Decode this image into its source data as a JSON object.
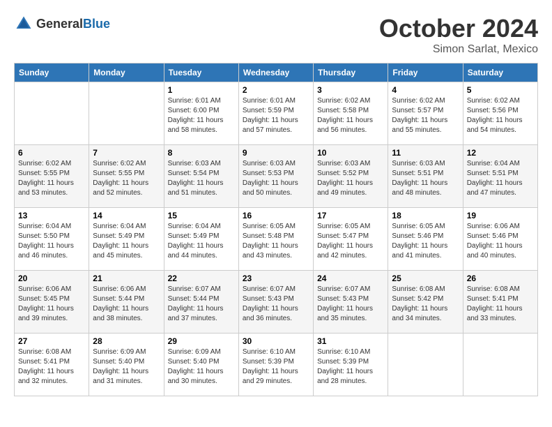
{
  "header": {
    "logo_general": "General",
    "logo_blue": "Blue",
    "month": "October 2024",
    "location": "Simon Sarlat, Mexico"
  },
  "weekdays": [
    "Sunday",
    "Monday",
    "Tuesday",
    "Wednesday",
    "Thursday",
    "Friday",
    "Saturday"
  ],
  "weeks": [
    [
      {
        "day": "",
        "info": ""
      },
      {
        "day": "",
        "info": ""
      },
      {
        "day": "1",
        "info": "Sunrise: 6:01 AM\nSunset: 6:00 PM\nDaylight: 11 hours and 58 minutes."
      },
      {
        "day": "2",
        "info": "Sunrise: 6:01 AM\nSunset: 5:59 PM\nDaylight: 11 hours and 57 minutes."
      },
      {
        "day": "3",
        "info": "Sunrise: 6:02 AM\nSunset: 5:58 PM\nDaylight: 11 hours and 56 minutes."
      },
      {
        "day": "4",
        "info": "Sunrise: 6:02 AM\nSunset: 5:57 PM\nDaylight: 11 hours and 55 minutes."
      },
      {
        "day": "5",
        "info": "Sunrise: 6:02 AM\nSunset: 5:56 PM\nDaylight: 11 hours and 54 minutes."
      }
    ],
    [
      {
        "day": "6",
        "info": "Sunrise: 6:02 AM\nSunset: 5:55 PM\nDaylight: 11 hours and 53 minutes."
      },
      {
        "day": "7",
        "info": "Sunrise: 6:02 AM\nSunset: 5:55 PM\nDaylight: 11 hours and 52 minutes."
      },
      {
        "day": "8",
        "info": "Sunrise: 6:03 AM\nSunset: 5:54 PM\nDaylight: 11 hours and 51 minutes."
      },
      {
        "day": "9",
        "info": "Sunrise: 6:03 AM\nSunset: 5:53 PM\nDaylight: 11 hours and 50 minutes."
      },
      {
        "day": "10",
        "info": "Sunrise: 6:03 AM\nSunset: 5:52 PM\nDaylight: 11 hours and 49 minutes."
      },
      {
        "day": "11",
        "info": "Sunrise: 6:03 AM\nSunset: 5:51 PM\nDaylight: 11 hours and 48 minutes."
      },
      {
        "day": "12",
        "info": "Sunrise: 6:04 AM\nSunset: 5:51 PM\nDaylight: 11 hours and 47 minutes."
      }
    ],
    [
      {
        "day": "13",
        "info": "Sunrise: 6:04 AM\nSunset: 5:50 PM\nDaylight: 11 hours and 46 minutes."
      },
      {
        "day": "14",
        "info": "Sunrise: 6:04 AM\nSunset: 5:49 PM\nDaylight: 11 hours and 45 minutes."
      },
      {
        "day": "15",
        "info": "Sunrise: 6:04 AM\nSunset: 5:49 PM\nDaylight: 11 hours and 44 minutes."
      },
      {
        "day": "16",
        "info": "Sunrise: 6:05 AM\nSunset: 5:48 PM\nDaylight: 11 hours and 43 minutes."
      },
      {
        "day": "17",
        "info": "Sunrise: 6:05 AM\nSunset: 5:47 PM\nDaylight: 11 hours and 42 minutes."
      },
      {
        "day": "18",
        "info": "Sunrise: 6:05 AM\nSunset: 5:46 PM\nDaylight: 11 hours and 41 minutes."
      },
      {
        "day": "19",
        "info": "Sunrise: 6:06 AM\nSunset: 5:46 PM\nDaylight: 11 hours and 40 minutes."
      }
    ],
    [
      {
        "day": "20",
        "info": "Sunrise: 6:06 AM\nSunset: 5:45 PM\nDaylight: 11 hours and 39 minutes."
      },
      {
        "day": "21",
        "info": "Sunrise: 6:06 AM\nSunset: 5:44 PM\nDaylight: 11 hours and 38 minutes."
      },
      {
        "day": "22",
        "info": "Sunrise: 6:07 AM\nSunset: 5:44 PM\nDaylight: 11 hours and 37 minutes."
      },
      {
        "day": "23",
        "info": "Sunrise: 6:07 AM\nSunset: 5:43 PM\nDaylight: 11 hours and 36 minutes."
      },
      {
        "day": "24",
        "info": "Sunrise: 6:07 AM\nSunset: 5:43 PM\nDaylight: 11 hours and 35 minutes."
      },
      {
        "day": "25",
        "info": "Sunrise: 6:08 AM\nSunset: 5:42 PM\nDaylight: 11 hours and 34 minutes."
      },
      {
        "day": "26",
        "info": "Sunrise: 6:08 AM\nSunset: 5:41 PM\nDaylight: 11 hours and 33 minutes."
      }
    ],
    [
      {
        "day": "27",
        "info": "Sunrise: 6:08 AM\nSunset: 5:41 PM\nDaylight: 11 hours and 32 minutes."
      },
      {
        "day": "28",
        "info": "Sunrise: 6:09 AM\nSunset: 5:40 PM\nDaylight: 11 hours and 31 minutes."
      },
      {
        "day": "29",
        "info": "Sunrise: 6:09 AM\nSunset: 5:40 PM\nDaylight: 11 hours and 30 minutes."
      },
      {
        "day": "30",
        "info": "Sunrise: 6:10 AM\nSunset: 5:39 PM\nDaylight: 11 hours and 29 minutes."
      },
      {
        "day": "31",
        "info": "Sunrise: 6:10 AM\nSunset: 5:39 PM\nDaylight: 11 hours and 28 minutes."
      },
      {
        "day": "",
        "info": ""
      },
      {
        "day": "",
        "info": ""
      }
    ]
  ]
}
